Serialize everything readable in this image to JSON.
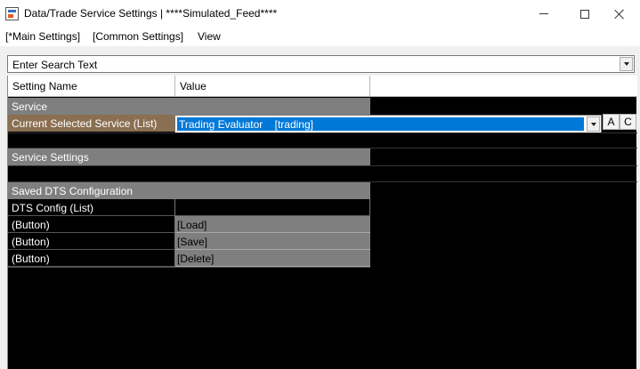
{
  "window": {
    "title": "Data/Trade Service Settings | ****Simulated_Feed****"
  },
  "menu": {
    "main_settings": "[*Main Settings]",
    "common_settings": "[Common Settings]",
    "view": "View"
  },
  "search": {
    "text": "Enter Search Text"
  },
  "grid": {
    "columns": [
      "Setting Name",
      "Value"
    ],
    "sections": {
      "service": "Service",
      "service_settings": "Service Settings",
      "saved_dts": "Saved DTS Configuration"
    },
    "service_row": {
      "label": "Current Selected Service (List)",
      "value": "Trading Evaluator    [trading]",
      "btn_a": "A",
      "btn_c": "C"
    },
    "dts_rows": [
      {
        "label": "DTS Config (List)",
        "value": ""
      },
      {
        "label": " (Button)",
        "value": "[Load]"
      },
      {
        "label": " (Button)",
        "value": "[Save]"
      },
      {
        "label": " (Button)",
        "value": "[Delete]"
      }
    ]
  },
  "colors": {
    "section_bg": "#7f7f7f",
    "selected_label_bg": "#8b6f52",
    "selection_blue": "#0078d7",
    "grid_bg": "#000000"
  }
}
